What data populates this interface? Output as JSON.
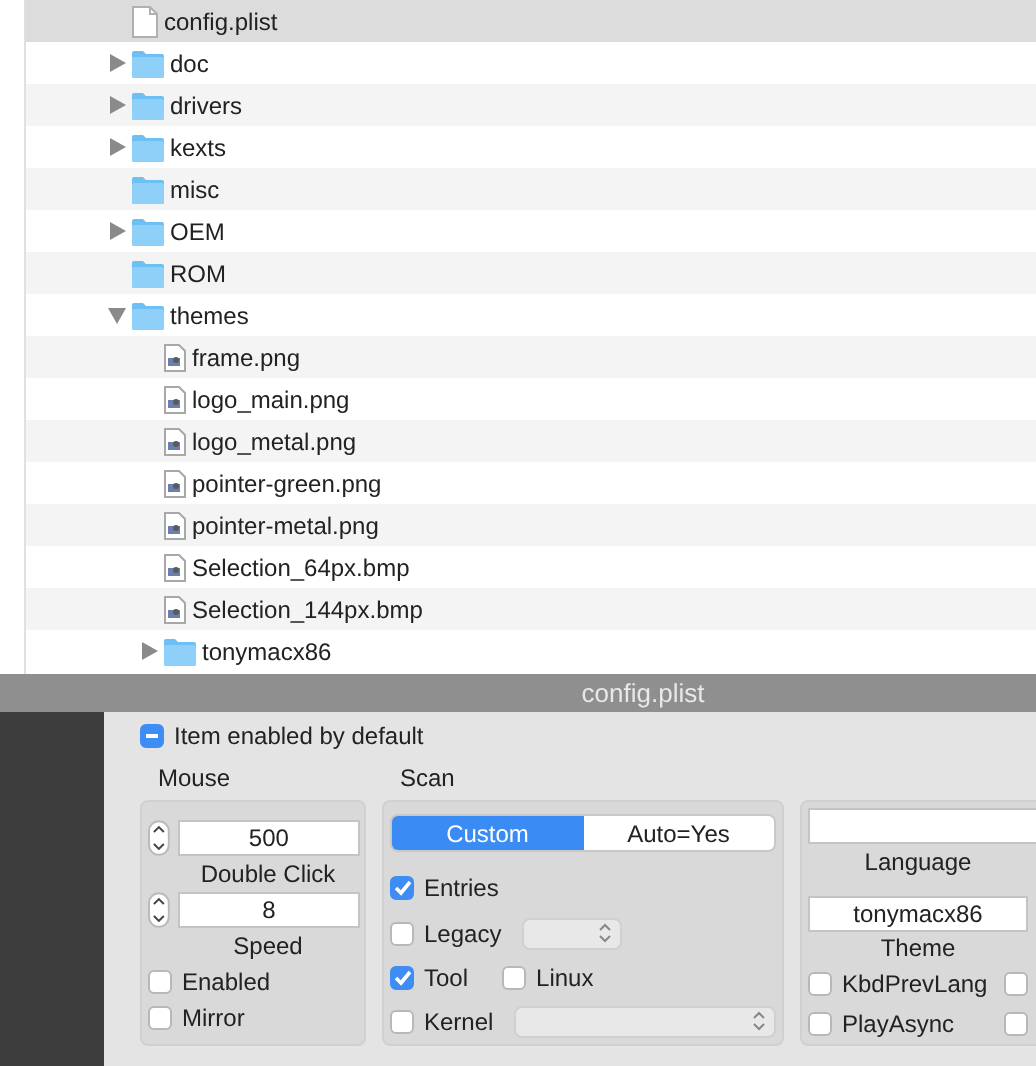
{
  "finder": {
    "rows": [
      {
        "kind": "file",
        "name": "config.plist",
        "selected": true
      },
      {
        "kind": "folder",
        "name": "doc",
        "expanded": false,
        "selected": false
      },
      {
        "kind": "folder",
        "name": "drivers",
        "expanded": false,
        "selected": false
      },
      {
        "kind": "folder",
        "name": "kexts",
        "expanded": false,
        "selected": false
      },
      {
        "kind": "folder",
        "name": "misc",
        "selected": false
      },
      {
        "kind": "folder",
        "name": "OEM",
        "expanded": false,
        "selected": false
      },
      {
        "kind": "folder",
        "name": "ROM",
        "selected": false
      },
      {
        "kind": "folder",
        "name": "themes",
        "expanded": true,
        "selected": false,
        "children": [
          {
            "kind": "image",
            "name": "frame.png",
            "selected": false
          },
          {
            "kind": "image",
            "name": "logo_main.png",
            "selected": false
          },
          {
            "kind": "image",
            "name": "logo_metal.png",
            "selected": false
          },
          {
            "kind": "image",
            "name": "pointer-green.png",
            "selected": false
          },
          {
            "kind": "image",
            "name": "pointer-metal.png",
            "selected": false
          },
          {
            "kind": "image",
            "name": "Selection_64px.bmp",
            "selected": false
          },
          {
            "kind": "image",
            "name": "Selection_144px.bmp",
            "selected": false
          },
          {
            "kind": "folder",
            "name": "tonymacx86",
            "expanded": false,
            "selected": false
          }
        ]
      }
    ]
  },
  "window": {
    "title": "config.plist"
  },
  "item_enabled": {
    "label": "Item enabled by default",
    "mixed": true
  },
  "mouse": {
    "title": "Mouse",
    "steppers": [
      {
        "value": "500",
        "label": "Double Click"
      },
      {
        "value": "8",
        "label": "Speed"
      }
    ],
    "checkboxes": [
      {
        "label": "Enabled",
        "checked": false
      },
      {
        "label": "Mirror",
        "checked": false
      }
    ]
  },
  "scan": {
    "title": "Scan",
    "segments": [
      {
        "label": "Custom",
        "selected": true
      },
      {
        "label": "Auto=Yes",
        "selected": false
      }
    ],
    "rows": [
      {
        "kind": "check",
        "label": "Entries",
        "checked": true
      },
      {
        "kind": "check_popup",
        "label": "Legacy",
        "checked": false
      },
      {
        "kind": "check_pair",
        "label": "Tool",
        "checked": true,
        "second_label": "Linux",
        "second_checked": false
      },
      {
        "kind": "check_wide_popup",
        "label": "Kernel",
        "checked": false
      }
    ]
  },
  "gui": {
    "language": {
      "label": "Language"
    },
    "theme": {
      "value": "tonymacx86",
      "label": "Theme"
    },
    "checkboxes": [
      {
        "label": "KbdPrevLang",
        "checked": false
      },
      {
        "label": "PlayAsync",
        "checked": false
      }
    ],
    "cut_checkboxes": [
      {
        "checked": false
      },
      {
        "checked": false
      }
    ]
  }
}
